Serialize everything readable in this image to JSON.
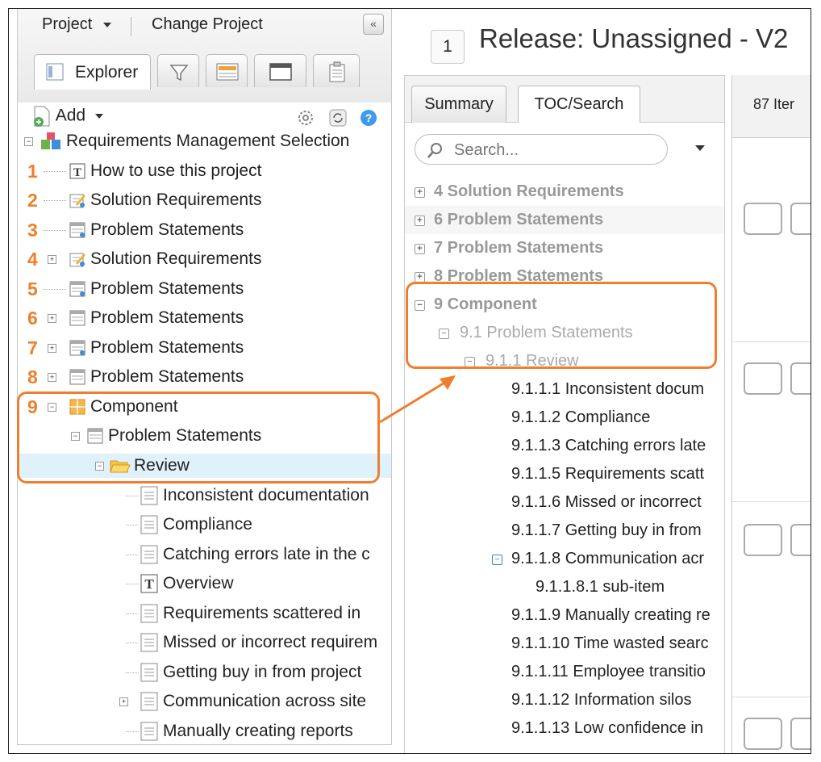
{
  "left": {
    "project_label": "Project",
    "change_project_label": "Change Project",
    "collapse_label": "«",
    "tabs": {
      "explorer": "Explorer"
    },
    "add_label": "Add"
  },
  "tree": {
    "root": "Requirements Management Selection",
    "items": [
      {
        "num": "1",
        "label": "How to use this project",
        "icon": "text-doc-icon"
      },
      {
        "num": "2",
        "label": "Solution Requirements",
        "icon": "edit-doc-icon"
      },
      {
        "num": "3",
        "label": "Problem Statements",
        "icon": "table-doc-icon"
      },
      {
        "num": "4",
        "label": "Solution Requirements",
        "icon": "edit-doc-icon"
      },
      {
        "num": "5",
        "label": "Problem Statements",
        "icon": "table-doc-icon"
      },
      {
        "num": "6",
        "label": "Problem Statements",
        "icon": "table-doc-icon"
      },
      {
        "num": "7",
        "label": "Problem Statements",
        "icon": "table-doc-icon"
      },
      {
        "num": "8",
        "label": "Problem Statements",
        "icon": "table-doc-icon"
      },
      {
        "num": "9",
        "label": "Component",
        "icon": "grid-icon"
      }
    ],
    "sub": {
      "problem": "Problem Statements",
      "review": "Review"
    },
    "leaves": [
      "Inconsistent documentation",
      "Compliance",
      "Catching errors late in the c",
      "Overview",
      "Requirements scattered in",
      "Missed or incorrect requirem",
      "Getting buy in from project",
      "Communication across site",
      "Manually creating reports"
    ]
  },
  "header": {
    "badge": "1",
    "title": "Release: Unassigned - V2"
  },
  "right": {
    "tabs": {
      "summary": "Summary",
      "toc": "TOC/Search"
    },
    "search_placeholder": "Search...",
    "toc": [
      "4 Solution Requirements",
      "6 Problem Statements",
      "7 Problem Statements",
      "8 Problem Statements",
      "9 Component",
      "9.1 Problem Statements",
      "9.1.1 Review",
      "9.1.1.1 Inconsistent docum",
      "9.1.1.2 Compliance",
      "9.1.1.3 Catching errors late",
      "9.1.1.5 Requirements scatt",
      "9.1.1.6 Missed or incorrect",
      "9.1.1.7 Getting buy in from",
      "9.1.1.8 Communication acr",
      "9.1.1.8.1 sub-item",
      "9.1.1.9 Manually creating re",
      "9.1.1.10 Time wasted searc",
      "9.1.1.11 Employee transitio",
      "9.1.1.12 Information silos",
      "9.1.1.13 Low confidence in"
    ]
  },
  "col3": {
    "items_label": "87 Iter"
  },
  "colors": {
    "accent": "#ef7f30",
    "selected": "#dff1fa"
  }
}
